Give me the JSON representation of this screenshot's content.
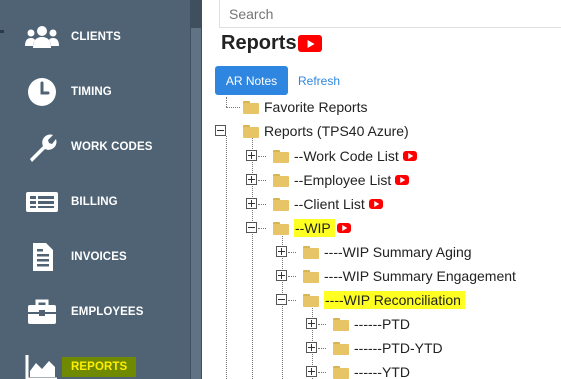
{
  "sidebar": {
    "items": [
      {
        "label": "CLIENTS",
        "icon": "people-icon"
      },
      {
        "label": "TIMING",
        "icon": "clock-icon"
      },
      {
        "label": "WORK CODES",
        "icon": "wrench-icon"
      },
      {
        "label": "BILLING",
        "icon": "billing-icon"
      },
      {
        "label": "INVOICES",
        "icon": "invoice-icon"
      },
      {
        "label": "EMPLOYEES",
        "icon": "briefcase-icon"
      },
      {
        "label": "REPORTS",
        "icon": "chart-icon",
        "active": true
      }
    ]
  },
  "search": {
    "placeholder": "Search",
    "value": ""
  },
  "page": {
    "title": "Reports"
  },
  "toolbar": {
    "ar_notes_label": "AR Notes",
    "refresh_label": "Refresh"
  },
  "tree": {
    "favorite": "Favorite Reports",
    "root": "Reports (TPS40 Azure)",
    "work_code_list": "--Work Code List",
    "employee_list": "--Employee List",
    "client_list": "--Client List",
    "wip": "--WIP",
    "wip_summary_aging": "----WIP Summary Aging",
    "wip_summary_engagement": "----WIP Summary Engagement",
    "wip_reconciliation": "----WIP Reconciliation",
    "ptd": "------PTD",
    "ptd_ytd": "------PTD-YTD",
    "ytd": "------YTD"
  },
  "colors": {
    "sidebar_bg": "#4f6375",
    "primary_button": "#2f86e0",
    "highlight": "#ffff22",
    "active_nav_bg": "#6f8a00",
    "active_nav_text": "#ffee00",
    "youtube_red": "#ff0000"
  }
}
